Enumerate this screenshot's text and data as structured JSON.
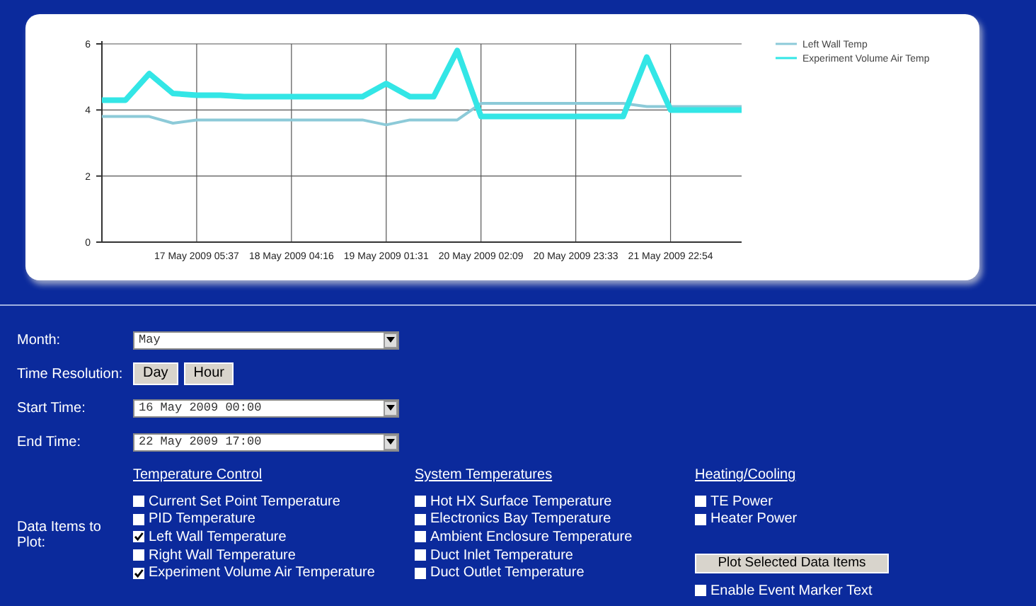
{
  "chart": {
    "chart_data": {
      "type": "line",
      "ylim": [
        0,
        6
      ],
      "yticks": [
        0,
        2,
        4,
        6
      ],
      "grid": true,
      "legend": "top-right",
      "categories": [
        null,
        null,
        null,
        null,
        "17 May 2009 05:37",
        null,
        null,
        null,
        "18 May 2009 04:16",
        null,
        null,
        null,
        "19 May 2009 01:31",
        null,
        null,
        null,
        "20 May 2009 02:09",
        null,
        null,
        null,
        "20 May 2009 23:33",
        null,
        null,
        null,
        "21 May 2009 22:54",
        null,
        null,
        null
      ],
      "series": [
        {
          "name": "Left Wall Temp",
          "color": "#8ccad8",
          "values": [
            3.8,
            3.8,
            3.8,
            3.6,
            3.7,
            3.7,
            3.7,
            3.7,
            3.7,
            3.7,
            3.7,
            3.7,
            3.55,
            3.7,
            3.7,
            3.7,
            4.2,
            4.2,
            4.2,
            4.2,
            4.2,
            4.2,
            4.2,
            4.1,
            4.1,
            4.1,
            4.1,
            4.1
          ]
        },
        {
          "name": "Experiment Volume Air Temp",
          "color": "#33e6e6",
          "values": [
            4.3,
            4.3,
            5.1,
            4.5,
            4.45,
            4.45,
            4.4,
            4.4,
            4.4,
            4.4,
            4.4,
            4.4,
            4.8,
            4.4,
            4.4,
            5.8,
            3.8,
            3.8,
            3.8,
            3.8,
            3.8,
            3.8,
            3.8,
            5.6,
            4.0,
            4.0,
            4.0,
            4.0
          ]
        }
      ]
    }
  },
  "form": {
    "month": {
      "label": "Month:",
      "value": "May"
    },
    "resolution": {
      "label": "Time Resolution:",
      "buttons": [
        "Day",
        "Hour"
      ]
    },
    "start": {
      "label": "Start Time:",
      "value": "16 May 2009 00:00"
    },
    "end": {
      "label": "End Time:",
      "value": "22 May 2009 17:00"
    },
    "items_label": "Data Items to Plot:",
    "groups": [
      {
        "heading": "Temperature Control",
        "items": [
          {
            "label": "Current Set Point Temperature",
            "checked": false
          },
          {
            "label": "PID Temperature",
            "checked": false
          },
          {
            "label": "Left Wall Temperature",
            "checked": true
          },
          {
            "label": "Right Wall Temperature",
            "checked": false
          },
          {
            "label": "Experiment Volume Air Temperature",
            "checked": true
          }
        ]
      },
      {
        "heading": "System Temperatures",
        "items": [
          {
            "label": "Hot HX Surface Temperature",
            "checked": false
          },
          {
            "label": "Electronics Bay Temperature",
            "checked": false
          },
          {
            "label": "Ambient Enclosure Temperature",
            "checked": false
          },
          {
            "label": "Duct Inlet Temperature",
            "checked": false
          },
          {
            "label": "Duct Outlet Temperature",
            "checked": false
          }
        ]
      },
      {
        "heading": "Heating/Cooling",
        "items": [
          {
            "label": "TE Power",
            "checked": false
          },
          {
            "label": "Heater Power",
            "checked": false
          }
        ]
      }
    ],
    "plot_button": "Plot Selected Data Items",
    "event_marker": {
      "label": "Enable Event Marker Text",
      "checked": false
    }
  }
}
